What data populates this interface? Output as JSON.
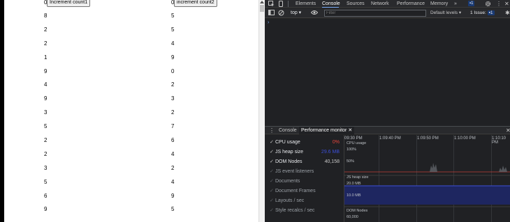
{
  "page": {
    "col1": {
      "value": "0",
      "button_label": "Increment count1",
      "numbers": [
        "8",
        "2",
        "2",
        "1",
        "9",
        "4",
        "9",
        "3",
        "5",
        "2",
        "2",
        "3",
        "5",
        "6",
        "9"
      ]
    },
    "col2": {
      "value": "0",
      "button_label": "increment count2",
      "numbers": [
        "5",
        "5",
        "4",
        "9",
        "0",
        "2",
        "3",
        "2",
        "7",
        "6",
        "4",
        "2",
        "4",
        "9",
        "5"
      ]
    }
  },
  "devtools": {
    "tabs": [
      "Elements",
      "Console",
      "Sources",
      "Network",
      "Performance",
      "Memory"
    ],
    "active_tab": "Console",
    "more_tabs": "»",
    "msg_badge": "1",
    "toolbar": {
      "context": "top",
      "filter_placeholder": "Filter",
      "levels": "Default levels",
      "issues_label": "1 Issue:",
      "issues_count": "1"
    },
    "console_prompt": "›",
    "drawer": {
      "tabs": [
        "Console",
        "Performance monitor"
      ],
      "active": "Performance monitor"
    },
    "metrics": [
      {
        "label": "CPU usage",
        "value": "0%",
        "checked": true,
        "color": "#e8453c"
      },
      {
        "label": "JS heap size",
        "value": "29.6 MB",
        "checked": true,
        "color": "#3c4fd9"
      },
      {
        "label": "DOM Nodes",
        "value": "40,158",
        "checked": true,
        "color": "#c8c8c8"
      },
      {
        "label": "JS event listeners",
        "value": "",
        "checked": false
      },
      {
        "label": "Documents",
        "value": "",
        "checked": false
      },
      {
        "label": "Document Frames",
        "value": "",
        "checked": false
      },
      {
        "label": "Layouts / sec",
        "value": "",
        "checked": false
      },
      {
        "label": "Style recalcs / sec",
        "value": "",
        "checked": false
      }
    ],
    "graph": {
      "time_labels": [
        "09:30 PM",
        "1:09:40 PM",
        "1:09:50 PM",
        "1:10:00 PM",
        "1:10:10 PM"
      ],
      "cpu_title": "CPU usage",
      "cpu_ticks": [
        "100%",
        "50%"
      ],
      "heap_title": "JS heap size",
      "heap_ticks": [
        "20.0 MB",
        "10.0 MB"
      ],
      "dom_title": "DOM Nodes",
      "dom_ticks": [
        "60,000"
      ]
    },
    "colors": {
      "cpu": "#e8453c",
      "heap": "#3c4fd9",
      "heap_fill": "#1e2660",
      "accent": "#7cacf8"
    }
  }
}
